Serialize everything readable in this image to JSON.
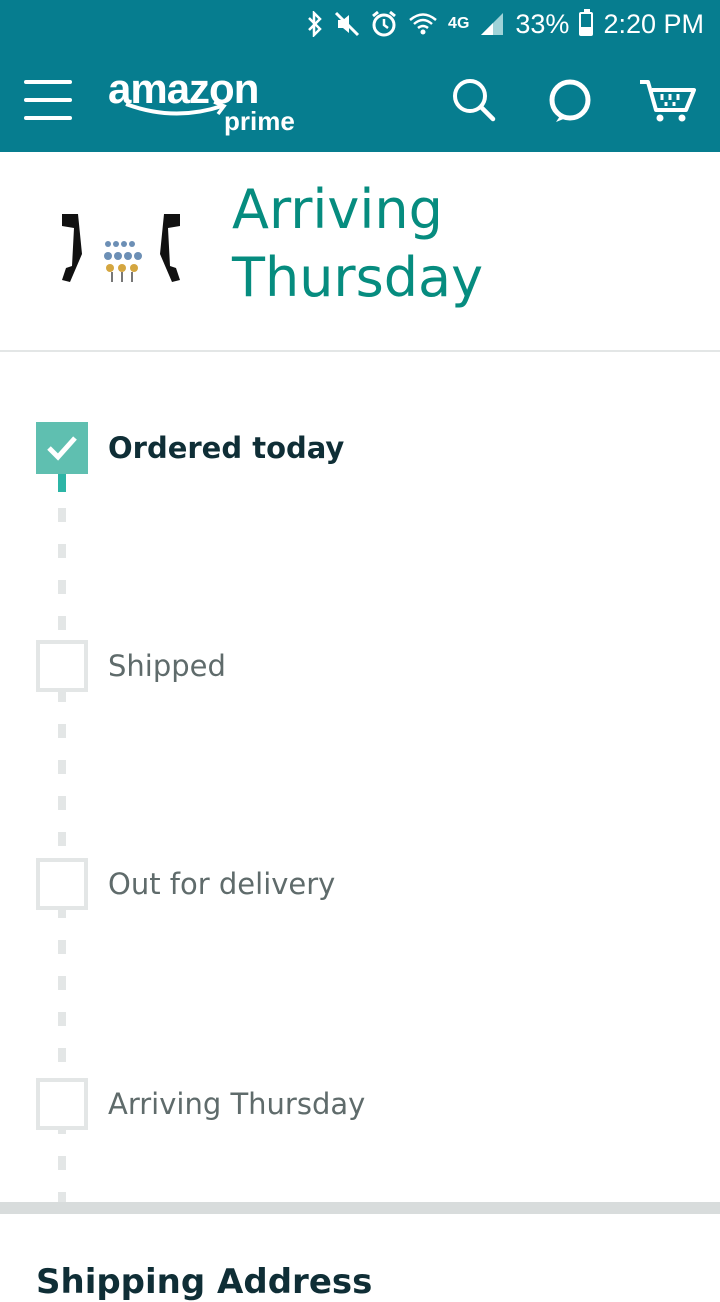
{
  "status_bar": {
    "battery": "33%",
    "time": "2:20 PM",
    "network": "4G",
    "icons": [
      "bluetooth-icon",
      "mute-icon",
      "alarm-icon",
      "wifi-icon",
      "network-4g-icon",
      "signal-icon",
      "battery-icon"
    ]
  },
  "header": {
    "logo_text": "amazon",
    "logo_sub": "prime",
    "icons": [
      "menu-icon",
      "search-icon",
      "alexa-icon",
      "cart-icon"
    ]
  },
  "delivery": {
    "headline": "Arriving\nThursday"
  },
  "tracker": {
    "steps": [
      {
        "label": "Ordered today",
        "done": true
      },
      {
        "label": "Shipped",
        "done": false
      },
      {
        "label": "Out for delivery",
        "done": false
      },
      {
        "label": "Arriving Thursday",
        "done": false
      }
    ]
  },
  "next_section": {
    "title": "Shipping Address"
  },
  "colors": {
    "header_bg": "#067D8F",
    "headline": "#068C7F",
    "check": "#5fbfb0"
  }
}
